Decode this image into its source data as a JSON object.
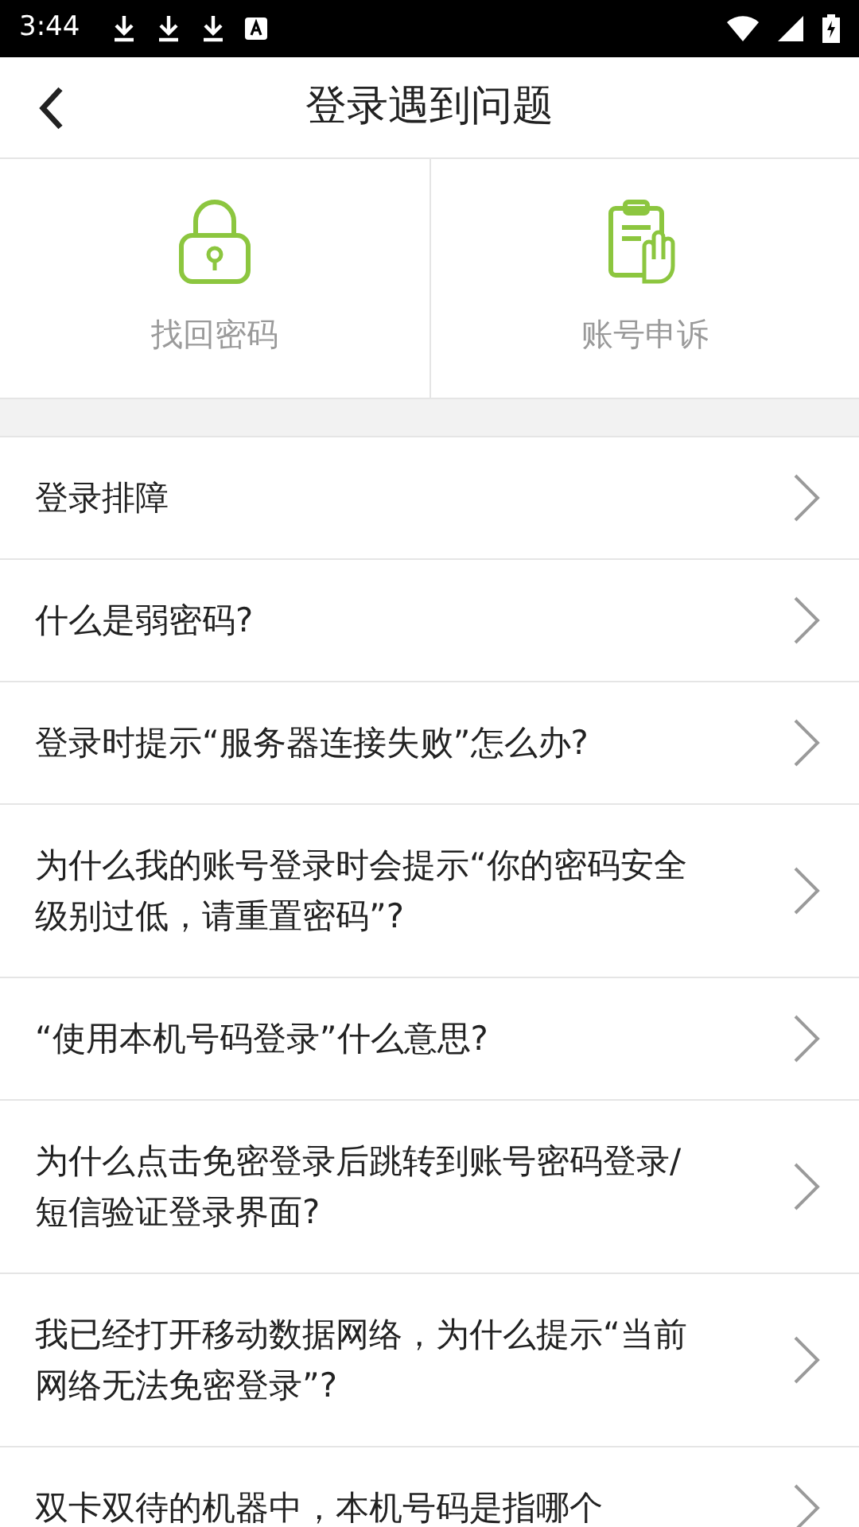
{
  "status_bar": {
    "time": "3:44"
  },
  "header": {
    "title": "登录遇到问题"
  },
  "shortcuts": [
    {
      "kind": "lock",
      "label": "找回密码"
    },
    {
      "kind": "appeal",
      "label": "账号申诉"
    }
  ],
  "faq": [
    {
      "text": "登录排障"
    },
    {
      "text": "什么是弱密码?"
    },
    {
      "text": "登录时提示“服务器连接失败”怎么办?"
    },
    {
      "text": "为什么我的账号登录时会提示“你的密码安全级别过低，请重置密码”?"
    },
    {
      "text": "“使用本机号码登录”什么意思?"
    },
    {
      "text": "为什么点击免密登录后跳转到账号密码登录/短信验证登录界面?"
    },
    {
      "text": "我已经打开移动数据网络，为什么提示“当前网络无法免密登录”?"
    },
    {
      "text": "双卡双待的机器中，本机号码是指哪个"
    }
  ]
}
